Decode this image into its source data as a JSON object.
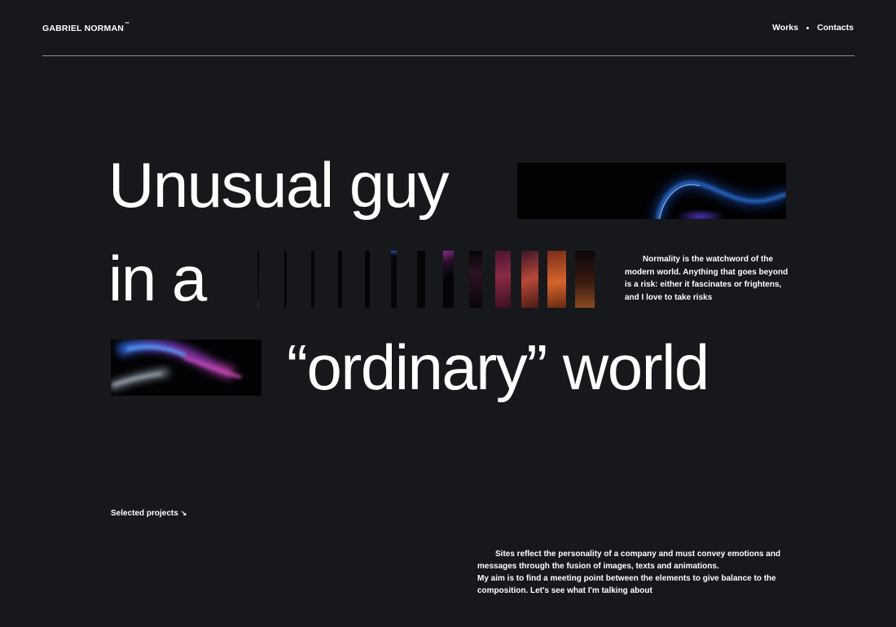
{
  "header": {
    "brand": "GABRIEL NORMAN",
    "brand_mark": "™",
    "nav": [
      {
        "label": "Works"
      },
      {
        "label": "Contacts"
      }
    ]
  },
  "hero": {
    "line1": "Unusual guy",
    "line2": "in a",
    "line3": "“ordinary” world",
    "intro": "Normality is the watchword of the modern world. Anything that goes beyond is a risk: either it fascinates or frightens, and I love to take risks"
  },
  "projects": {
    "label": "Selected projects",
    "arrow": "↘"
  },
  "about": {
    "para1": "Sites reflect the personality of a company and must convey emotions and messages through the fusion of images, texts and animations.",
    "para2": "My aim is to find a meeting point between the elements to give balance to the composition. Let's see what I'm talking about"
  },
  "colors": {
    "background": "#17181c",
    "text": "#ffffff",
    "divider": "#8a8b90",
    "glow_blue": "#2f7cff",
    "glow_magenta": "#c23fa8",
    "glow_orange": "#d4642c"
  }
}
